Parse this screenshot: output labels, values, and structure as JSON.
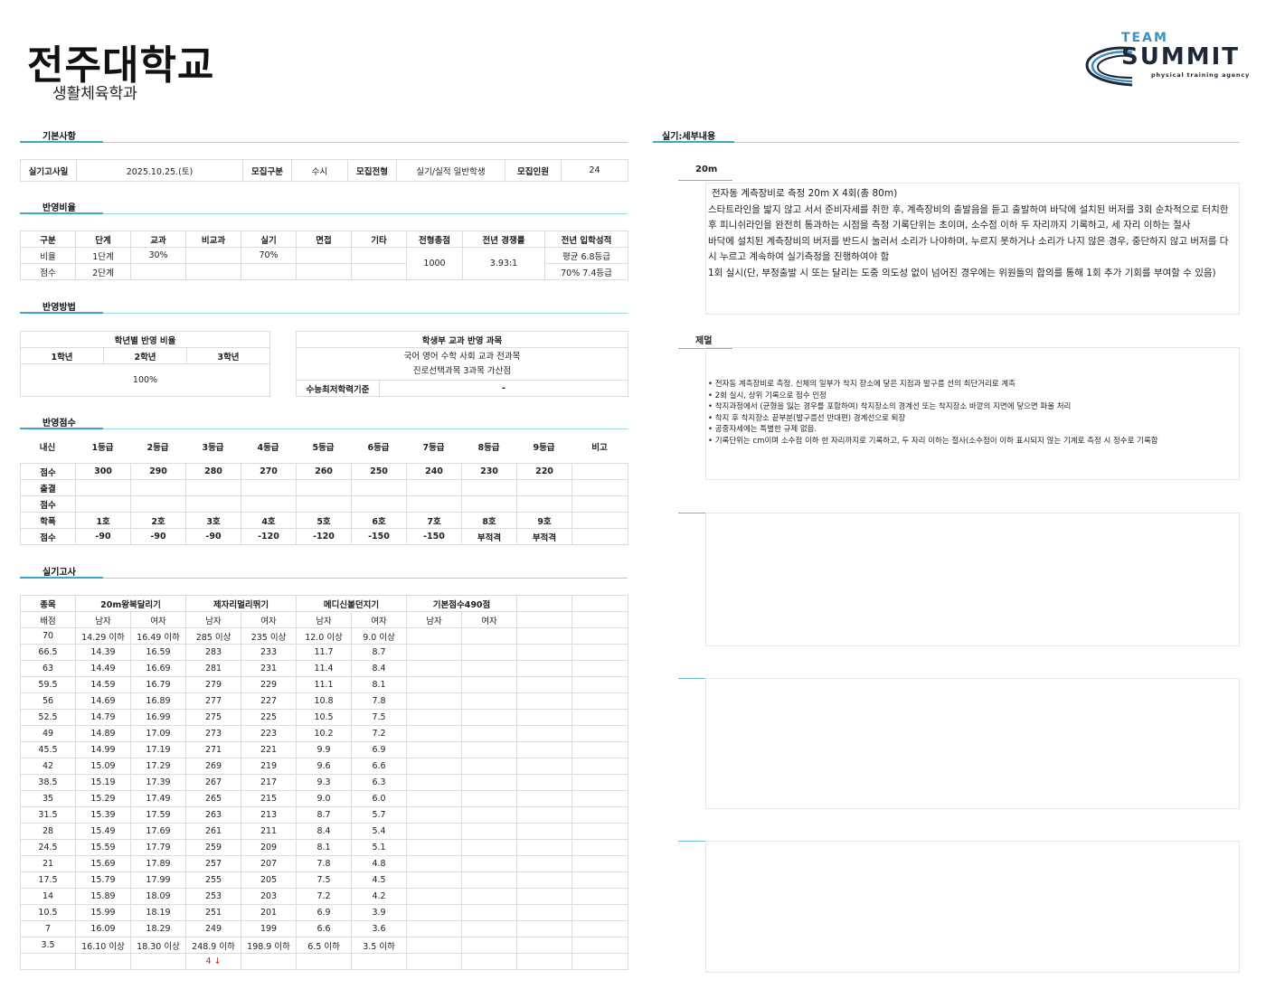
{
  "header": {
    "title": "전주대학교",
    "subtitle": "생활체육학과"
  },
  "logo": {
    "team": "TEAM",
    "summit": "SUMMIT",
    "agency": "physical training agency"
  },
  "sections": {
    "basic": "기본사항",
    "ratio": "반영비율",
    "method": "반영방법",
    "score": "반영점수",
    "exam": "실기고사",
    "detail": "실기:세부내용"
  },
  "basic": {
    "cells": [
      "실기고사일",
      "2025.10.25.(토)",
      "모집구분",
      "수시",
      "모집전형",
      "실기/실적 일반학생",
      "모집인원",
      "24"
    ]
  },
  "ratio": {
    "headers": [
      "구분",
      "단계",
      "교과",
      "비교과",
      "실기",
      "면접",
      "기타",
      "전형총점",
      "전년 경쟁률",
      "전년 입학성적"
    ],
    "row1": [
      "비율",
      "1단계",
      "30%",
      "",
      "70%",
      "",
      ""
    ],
    "row2": [
      "점수",
      "2단계",
      "",
      "",
      "",
      "",
      ""
    ],
    "total": "1000",
    "competition": "3.93:1",
    "grade1": "평균 6.8등급",
    "grade2": "70% 7.4등급"
  },
  "method": {
    "grade_title": "학년별 반영 비율",
    "grade_headers": [
      "1학년",
      "2학년",
      "3학년"
    ],
    "grade_value": "100%",
    "subject_title": "학생부 교과 반영 과목",
    "subject_line1": "국어 영어 수학 사회 교과 전과목",
    "subject_line2": "진로선택과목 3과목 가산점",
    "csat_label": "수능최저학력기준",
    "csat_value": "-"
  },
  "score": {
    "headers": [
      "내신",
      "1등급",
      "2등급",
      "3등급",
      "4등급",
      "5등급",
      "6등급",
      "7등급",
      "8등급",
      "9등급",
      "비고"
    ],
    "rows": [
      [
        "점수",
        "300",
        "290",
        "280",
        "270",
        "260",
        "250",
        "240",
        "230",
        "220",
        ""
      ],
      [
        "출결",
        "",
        "",
        "",
        "",
        "",
        "",
        "",
        "",
        "",
        ""
      ],
      [
        "점수",
        "",
        "",
        "",
        "",
        "",
        "",
        "",
        "",
        "",
        ""
      ],
      [
        "학폭",
        "1호",
        "2호",
        "3호",
        "4호",
        "5호",
        "6호",
        "7호",
        "8호",
        "9호",
        ""
      ],
      [
        "점수",
        "-90",
        "-90",
        "-90",
        "-120",
        "-120",
        "-150",
        "-150",
        "부적격",
        "부적격",
        ""
      ]
    ]
  },
  "exam": {
    "headers": [
      "종목",
      "20m왕복달리기",
      "제자리멀리뛰기",
      "메디신볼던지기",
      "기본점수490점"
    ],
    "subheaders": [
      "배점",
      "남자",
      "여자",
      "남자",
      "여자",
      "남자",
      "여자",
      "남자",
      "여자",
      "",
      ""
    ],
    "rows": [
      [
        "70",
        "14.29 이하",
        "16.49 이하",
        "285 이상",
        "235 이상",
        "12.0 이상",
        "9.0 이상"
      ],
      [
        "66.5",
        "14.39",
        "16.59",
        "283",
        "233",
        "11.7",
        "8.7"
      ],
      [
        "63",
        "14.49",
        "16.69",
        "281",
        "231",
        "11.4",
        "8.4"
      ],
      [
        "59.5",
        "14.59",
        "16.79",
        "279",
        "229",
        "11.1",
        "8.1"
      ],
      [
        "56",
        "14.69",
        "16.89",
        "277",
        "227",
        "10.8",
        "7.8"
      ],
      [
        "52.5",
        "14.79",
        "16.99",
        "275",
        "225",
        "10.5",
        "7.5"
      ],
      [
        "49",
        "14.89",
        "17.09",
        "273",
        "223",
        "10.2",
        "7.2"
      ],
      [
        "45.5",
        "14.99",
        "17.19",
        "271",
        "221",
        "9.9",
        "6.9"
      ],
      [
        "42",
        "15.09",
        "17.29",
        "269",
        "219",
        "9.6",
        "6.6"
      ],
      [
        "38.5",
        "15.19",
        "17.39",
        "267",
        "217",
        "9.3",
        "6.3"
      ],
      [
        "35",
        "15.29",
        "17.49",
        "265",
        "215",
        "9.0",
        "6.0"
      ],
      [
        "31.5",
        "15.39",
        "17.59",
        "263",
        "213",
        "8.7",
        "5.7"
      ],
      [
        "28",
        "15.49",
        "17.69",
        "261",
        "211",
        "8.4",
        "5.4"
      ],
      [
        "24.5",
        "15.59",
        "17.79",
        "259",
        "209",
        "8.1",
        "5.1"
      ],
      [
        "21",
        "15.69",
        "17.89",
        "257",
        "207",
        "7.8",
        "4.8"
      ],
      [
        "17.5",
        "15.79",
        "17.99",
        "255",
        "205",
        "7.5",
        "4.5"
      ],
      [
        "14",
        "15.89",
        "18.09",
        "253",
        "203",
        "7.2",
        "4.2"
      ],
      [
        "10.5",
        "15.99",
        "18.19",
        "251",
        "201",
        "6.9",
        "3.9"
      ],
      [
        "7",
        "16.09",
        "18.29",
        "249",
        "199",
        "6.6",
        "3.6"
      ],
      [
        "3.5",
        "16.10 이상",
        "18.30 이상",
        "248.9 이하",
        "198.9 이하",
        "6.5 이하",
        "3.5 이하"
      ]
    ],
    "footnote": "4 ↓"
  },
  "detail": {
    "event1_title": "20m",
    "event1_lines": [
      "전자동 계측장비로 측정 20m X 4회(총 80m)",
      "스타트라인을 밟지 않고 서서 준비자세를 취한 후, 계측장비의 출발음을 듣고 출발하여 바닥에 설치된 버저를 3회 순차적으로 터치한 후 피니쉬라인을 완전히 통과하는 시점을 측정 기록단위는 초이며, 소수점 이하 두 자리까지 기록하고, 세 자리 이하는 절사",
      "바닥에 설치된 계측장비의 버저를 반드시 눌러서 소리가 나야하며, 누르지 못하거나 소리가 나지 않은 경우, 중단하지 않고 버저를 다시 누르고 계속하여 실기측정을 진행하여야 함",
      "1회 실시(단, 부정출발 시 또는 달리는 도중 의도성 없이 넘어진 경우에는 위원들의 합의를 통해 1회 추가 기회를 부여할 수 있음)"
    ],
    "event2_title": "제멀",
    "event2_items": [
      "전자동 계측장비로 측정. 신체의 일부가 착지 장소에 닿은 지점과 발구름 선의 최단거리로 계측",
      "2회 실시, 상위 기록으로 점수 인정",
      "착지과정에서 (균형을 잃는 경우를 포함하여) 착지장소의 경계선 또는 착지장소 바깥의 지면에 닿으면 파울 처리",
      "착지 후 착지장소 끝부분(발구름선 반대편) 경계선으로 퇴장",
      "공중자세에는 특별한 규제 없음.",
      "기록단위는 cm이며 소수점 이하 한 자리까지로 기록하고, 두 자리 이하는 절사(소수점이 이하 표시되지 않는 기계로 측정 시 정수로 기록함"
    ]
  },
  "colors": {
    "accent": "#3aa9cc",
    "line": "#9fd4e4",
    "footnote": "#d52020"
  }
}
